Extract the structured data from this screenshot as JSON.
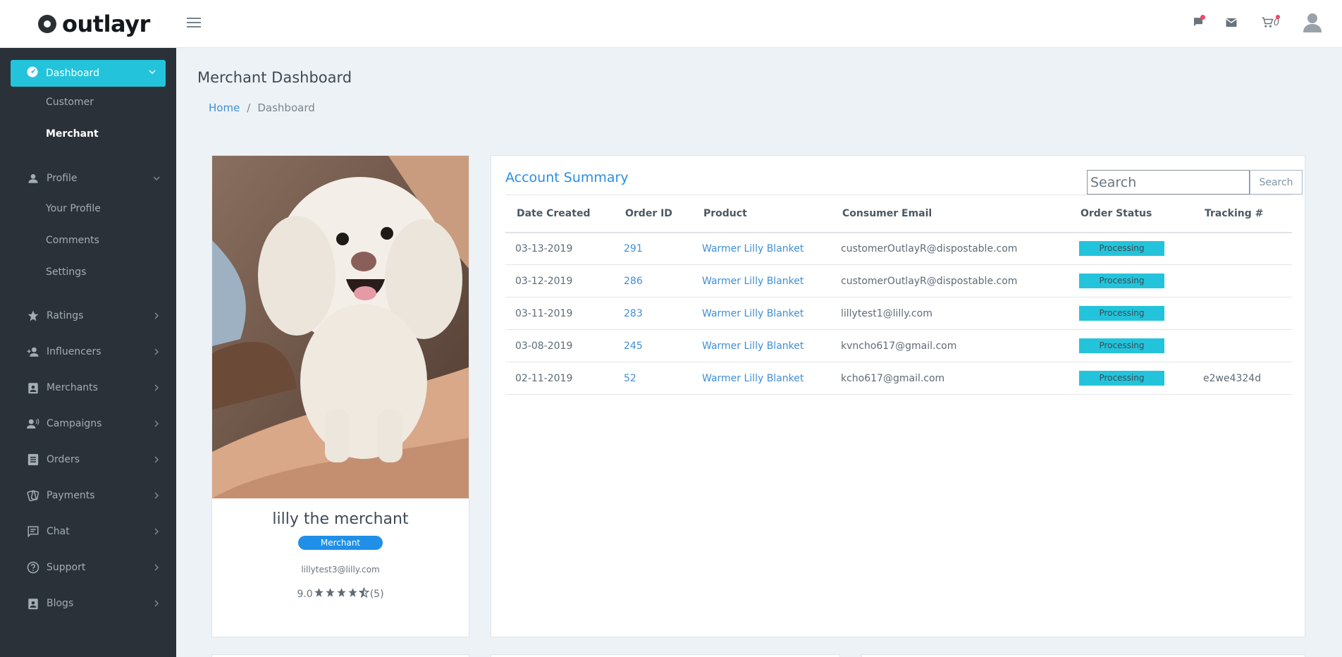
{
  "brand": {
    "name": "outlayr"
  },
  "colors": {
    "accent": "#23c4db",
    "link": "#3f8fd6",
    "sidebar": "#2a3138",
    "badge": "#1f8fe8"
  },
  "header": {
    "icons": [
      "flag-icon",
      "mail-icon",
      "cart-icon",
      "user-avatar-icon"
    ],
    "cart_count": "0"
  },
  "sidebar": {
    "active": {
      "label": "Dashboard",
      "icon": "dashboard-icon"
    },
    "dashboard_sub": [
      "Customer",
      "Merchant"
    ],
    "profile": {
      "label": "Profile",
      "icon": "person-icon",
      "sub": [
        "Your Profile",
        "Comments",
        "Settings"
      ]
    },
    "items": [
      {
        "label": "Ratings",
        "icon": "star-icon"
      },
      {
        "label": "Influencers",
        "icon": "add-person-icon"
      },
      {
        "label": "Merchants",
        "icon": "badge-icon"
      },
      {
        "label": "Campaigns",
        "icon": "group-voice-icon"
      },
      {
        "label": "Orders",
        "icon": "list-icon"
      },
      {
        "label": "Payments",
        "icon": "cards-icon"
      },
      {
        "label": "Chat",
        "icon": "chat-icon"
      },
      {
        "label": "Support",
        "icon": "help-icon"
      },
      {
        "label": "Blogs",
        "icon": "badge-icon"
      }
    ]
  },
  "page": {
    "title": "Merchant Dashboard",
    "breadcrumb": {
      "home": "Home",
      "sep": "/",
      "current": "Dashboard"
    }
  },
  "profile_card": {
    "name": "lilly the merchant",
    "role": "Merchant",
    "email": "lillytest3@lilly.com",
    "rating_value": "9.0",
    "rating_stars": 4.5,
    "rating_count": "(5)"
  },
  "summary": {
    "title": "Account Summary",
    "search_placeholder": "Search",
    "search_button": "Search",
    "columns": [
      "Date Created",
      "Order ID",
      "Product",
      "Consumer Email",
      "Order Status",
      "Tracking #"
    ],
    "rows": [
      {
        "date": "03-13-2019",
        "id": "291",
        "product": "Warmer Lilly Blanket",
        "email": "customerOutlayR@dispostable.com",
        "status": "Processing",
        "tracking": ""
      },
      {
        "date": "03-12-2019",
        "id": "286",
        "product": "Warmer Lilly Blanket",
        "email": "customerOutlayR@dispostable.com",
        "status": "Processing",
        "tracking": ""
      },
      {
        "date": "03-11-2019",
        "id": "283",
        "product": "Warmer Lilly Blanket",
        "email": "lillytest1@lilly.com",
        "status": "Processing",
        "tracking": ""
      },
      {
        "date": "03-08-2019",
        "id": "245",
        "product": "Warmer Lilly Blanket",
        "email": "kvncho617@gmail.com",
        "status": "Processing",
        "tracking": ""
      },
      {
        "date": "02-11-2019",
        "id": "52",
        "product": "Warmer Lilly Blanket",
        "email": "kcho617@gmail.com",
        "status": "Processing",
        "tracking": "e2we4324d"
      }
    ]
  }
}
